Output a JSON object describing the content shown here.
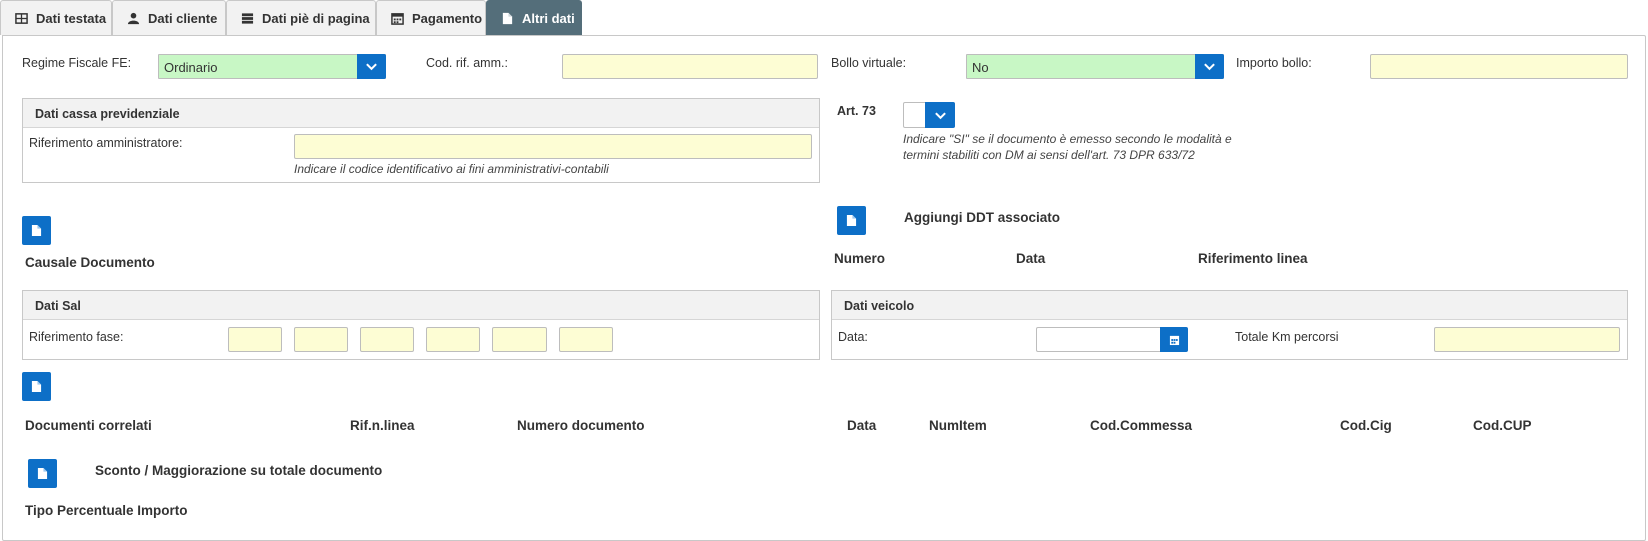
{
  "tabs": [
    {
      "label": "Dati testata",
      "icon": "table-icon"
    },
    {
      "label": "Dati cliente",
      "icon": "user-icon"
    },
    {
      "label": "Dati piè di pagina",
      "icon": "list-icon"
    },
    {
      "label": "Pagamento",
      "icon": "calendar-icon"
    },
    {
      "label": "Altri dati",
      "icon": "document-icon",
      "active": true
    }
  ],
  "row1": {
    "regime_label": "Regime Fiscale FE:",
    "regime_value": "Ordinario",
    "cod_rif_label": "Cod. rif. amm.:",
    "cod_rif_value": "",
    "bollo_label": "Bollo virtuale:",
    "bollo_value": "No",
    "importo_label": "Importo bollo:",
    "importo_value": ""
  },
  "cassa": {
    "title": "Dati cassa previdenziale",
    "rif_label": "Riferimento amministratore:",
    "rif_value": "",
    "rif_hint": "Indicare il codice identificativo ai fini amministrativi-contabili"
  },
  "art73": {
    "label": "Art. 73",
    "value": "",
    "hint_line1": "Indicare \"SI\" se il documento è emesso secondo le modalità e",
    "hint_line2": "termini stabiliti con DM ai sensi dell'art. 73 DPR 633/72"
  },
  "causale": {
    "label": "Causale Documento"
  },
  "ddt": {
    "title": "Aggiungi DDT associato",
    "columns": [
      "Numero",
      "Data",
      "Riferimento linea"
    ]
  },
  "sal": {
    "title": "Dati Sal",
    "rif_label": "Riferimento fase:",
    "values": [
      "",
      "",
      "",
      "",
      "",
      ""
    ]
  },
  "veicolo": {
    "title": "Dati veicolo",
    "data_label": "Data:",
    "data_value": "",
    "km_label": "Totale Km percorsi",
    "km_value": ""
  },
  "correlati": {
    "columns": [
      "Documenti correlati",
      "Rif.n.linea",
      "Numero documento",
      "Data",
      "NumItem",
      "Cod.Commessa",
      "Cod.Cig",
      "Cod.CUP"
    ]
  },
  "sconto": {
    "title": "Sconto / Maggiorazione su totale documento",
    "columns_text": "Tipo Percentuale Importo"
  },
  "colors": {
    "tab_active": "#546e7a",
    "accent_blue": "#0d6fc7",
    "select_green": "#c8f7c5",
    "input_yellow": "#fdfdd4"
  }
}
